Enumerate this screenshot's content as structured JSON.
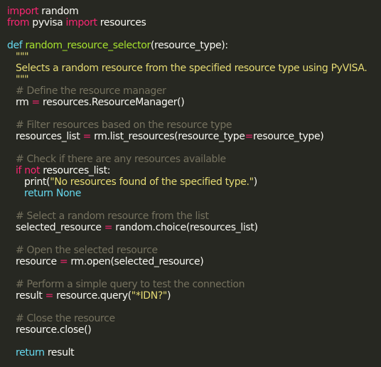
{
  "code": {
    "l1": {
      "kw": "import",
      "rest": " random"
    },
    "l2": {
      "kw1": "from",
      "mid": " pyvisa ",
      "kw2": "import",
      "rest": " resources"
    },
    "l4": {
      "kw": "def",
      "space": " ",
      "fn": "random_resource_selector",
      "rest": "(resource_type):"
    },
    "l5": "\"\"\"",
    "l6": "Selects a random resource from the specified resource type using PyVISA.",
    "l7": "\"\"\"",
    "l8": "# Define the resource manager",
    "l9": {
      "a": "rm",
      "op": " = ",
      "b": "resources.ResourceManager()"
    },
    "l11": "# Filter resources based on the resource type",
    "l12": {
      "a": "resources_list",
      "op": " = ",
      "b": "rm.list_resources(resource_type",
      "op2": "=",
      "c": "resource_type)"
    },
    "l14": "# Check if there are any resources available",
    "l15": {
      "kw": "if",
      "sp": " ",
      "kw2": "not",
      "rest": " resources_list:"
    },
    "l16": {
      "a": "print(",
      "str": "\"No resources found of the specified type.\"",
      "b": ")"
    },
    "l17": {
      "kw": "return",
      "sp": " ",
      "cn": "None"
    },
    "l19": "# Select a random resource from the list",
    "l20": {
      "a": "selected_resource",
      "op": " = ",
      "b": "random.choice(resources_list)"
    },
    "l22": "# Open the selected resource",
    "l23": {
      "a": "resource",
      "op": " = ",
      "b": "rm.open(selected_resource)"
    },
    "l25": "# Perform a simple query to test the connection",
    "l26": {
      "a": "result",
      "op": " = ",
      "b": "resource.query(",
      "str": "\"*IDN?\"",
      "c": ")"
    },
    "l28": "# Close the resource",
    "l29": "resource.close()",
    "l31": {
      "kw": "return",
      "rest": " result"
    }
  },
  "colors": {
    "background": "#272822",
    "keyword": "#f92672",
    "builtin": "#66d9ef",
    "function": "#a6e22e",
    "string": "#e6db74",
    "comment": "#75715e",
    "text": "#f8f8f2"
  }
}
